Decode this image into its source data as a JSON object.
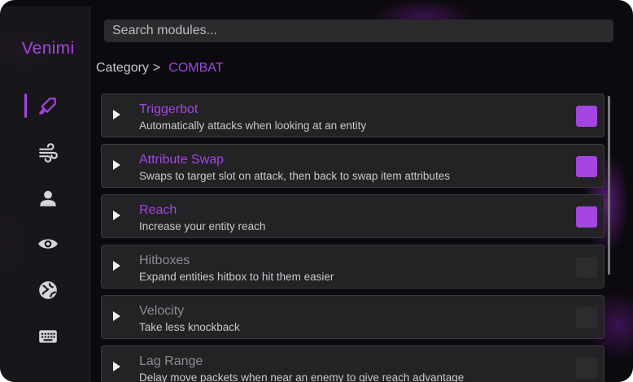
{
  "app": {
    "brand": "Venimi"
  },
  "search": {
    "placeholder": "Search modules..."
  },
  "breadcrumb": {
    "label": "Category",
    "separator": ">",
    "category": "COMBAT"
  },
  "colors": {
    "accent": "#a445e0",
    "background": "#0c0a0e",
    "card": "#242326"
  },
  "nav": [
    {
      "icon": "rocket-icon",
      "active": true
    },
    {
      "icon": "wind-icon",
      "active": false
    },
    {
      "icon": "person-icon",
      "active": false
    },
    {
      "icon": "eye-icon",
      "active": false
    },
    {
      "icon": "globe-icon",
      "active": false
    },
    {
      "icon": "keyboard-icon",
      "active": false
    }
  ],
  "modules": [
    {
      "name": "Triggerbot",
      "description": "Automatically attacks when looking at an entity",
      "enabled": true
    },
    {
      "name": "Attribute Swap",
      "description": "Swaps to target slot on attack, then back to swap item attributes",
      "enabled": true
    },
    {
      "name": "Reach",
      "description": "Increase your entity reach",
      "enabled": true
    },
    {
      "name": "Hitboxes",
      "description": "Expand entities hitbox to hit them easier",
      "enabled": false
    },
    {
      "name": "Velocity",
      "description": "Take less knockback",
      "enabled": false
    },
    {
      "name": "Lag Range",
      "description": "Delay move packets when near an enemy to give reach advantage",
      "enabled": false
    }
  ]
}
